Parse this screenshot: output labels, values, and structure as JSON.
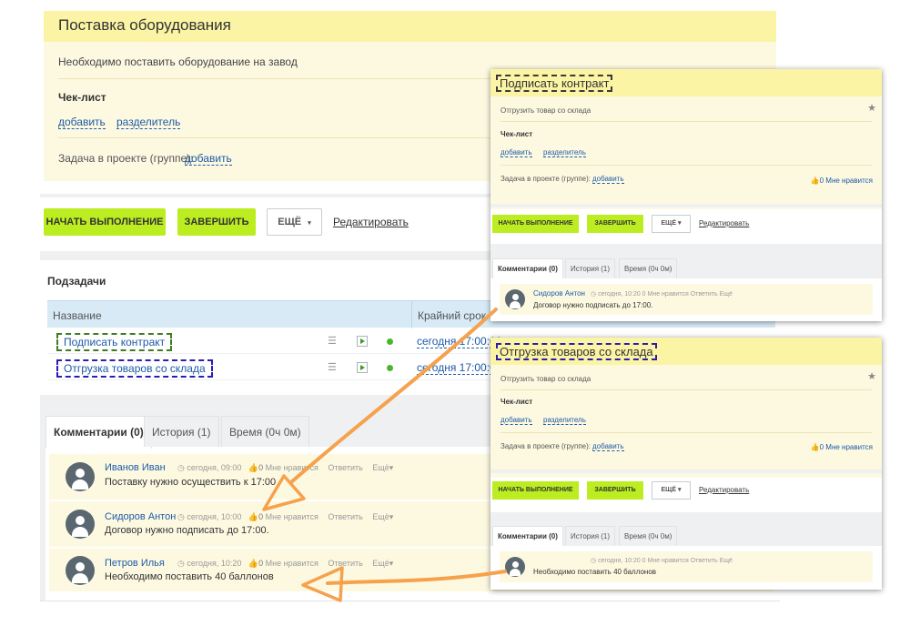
{
  "task": {
    "title": "Поставка оборудования",
    "description": "Необходимо поставить оборудование на завод",
    "checklist_title": "Чек-лист",
    "checklist_add": "добавить",
    "checklist_separator": "разделитель",
    "project_label": "Задача в проекте (группе):",
    "project_add": "добавить"
  },
  "actions": {
    "start": "НАЧАТЬ ВЫПОЛНЕНИЕ",
    "finish": "ЗАВЕРШИТЬ",
    "more": "ЕЩЁ",
    "edit": "Редактировать"
  },
  "subtasks": {
    "title": "Подзадачи",
    "col_name": "Название",
    "col_due": "Крайний срок",
    "rows": [
      {
        "name": "Подписать контракт",
        "due": "сегодня 17:00:00"
      },
      {
        "name": "Отгрузка товаров со склада",
        "due": "сегодня 17:00:00"
      }
    ]
  },
  "tabs": [
    "Комментарии (0)",
    "История (1)",
    "Время (0ч 0м)"
  ],
  "comments": [
    {
      "author": "Иванов Иван",
      "time": "сегодня, 09:00",
      "likes": "0",
      "like_label": "Мне нравится",
      "reply": "Ответить",
      "more": "Ещё",
      "text": "Поставку нужно осуществить к 17:00"
    },
    {
      "author": "Сидоров Антон",
      "time": "сегодня, 10:00",
      "likes": "0",
      "like_label": "Мне нравится",
      "reply": "Ответить",
      "more": "Ещё",
      "text": "Договор нужно подписать до 17:00."
    },
    {
      "author": "Петров Илья",
      "time": "сегодня, 10:20",
      "likes": "0",
      "like_label": "Мне нравится",
      "reply": "Ответить",
      "more": "Ещё",
      "text": "Необходимо поставить 40 баллонов"
    }
  ],
  "popup1": {
    "title": "Подписать контракт",
    "description": "Отгрузить товар со склада",
    "checklist_title": "Чек-лист",
    "checklist_add": "добавить",
    "checklist_separator": "разделитель",
    "project_label": "Задача в проекте (группе):",
    "project_add": "добавить",
    "like": "0 Мне нравится",
    "comment": {
      "author": "Сидоров Антон",
      "meta": "сегодня, 10:20   0 Мне нравится   Ответить   Ещё",
      "text": "Договор нужно подписать до 17:00."
    }
  },
  "popup2": {
    "title": "Отгрузка товаров со склада",
    "description": "Отгрузить товар со склада",
    "checklist_title": "Чек-лист",
    "checklist_add": "добавить",
    "checklist_separator": "разделитель",
    "project_label": "Задача в проекте (группе):",
    "project_add": "добавить",
    "like": "0 Мне нравится",
    "comment": {
      "meta": "сегодня, 10:20   0 Мне нравится   Ответить   Ещё",
      "text": "Необходимо поставить 40 баллонов"
    }
  },
  "colors": {
    "header_yellow": "#fbf4a4",
    "body_yellow": "#fdf9e1",
    "button_green": "#bbed21",
    "link_blue": "#1d5aa8",
    "arrow_orange": "#f6a24d"
  },
  "icons": [
    "star-icon",
    "like-icon",
    "clock-icon",
    "menu-icon",
    "play-icon",
    "status-dot-icon",
    "avatar-icon",
    "chevron-down-icon"
  ]
}
